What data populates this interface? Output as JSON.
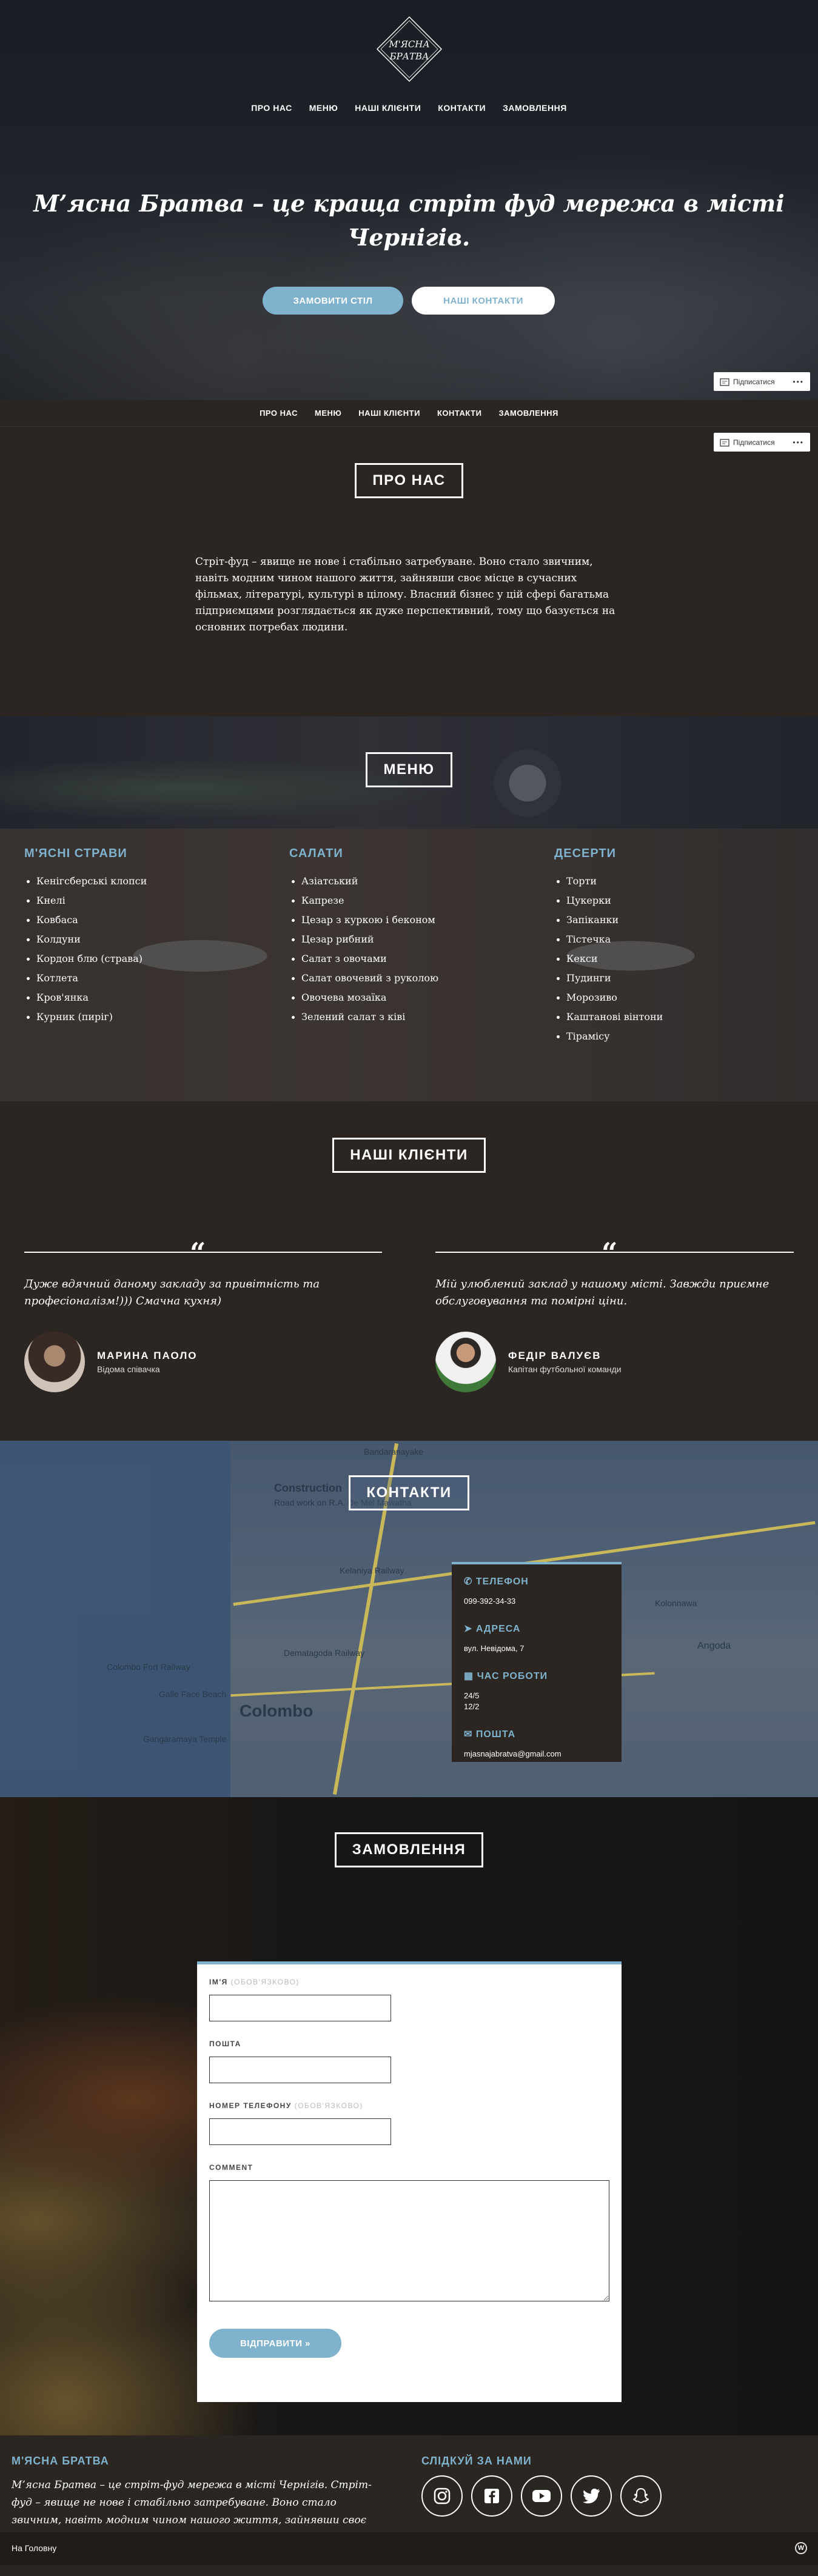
{
  "hero": {
    "logo_line1": "М'ЯСНА",
    "logo_line2": "БРАТВА",
    "title": "М’ясна Братва – це краща стріт фуд мережа в місті Чернігів.",
    "btn_order": "ЗАМОВИТИ СТІЛ",
    "btn_contacts": "НАШІ КОНТАКТИ"
  },
  "nav": [
    "ПРО НАС",
    "МЕНЮ",
    "НАШІ КЛІЄНТИ",
    "КОНТАКТИ",
    "ЗАМОВЛЕННЯ"
  ],
  "follow_label": "Підписатися",
  "about": {
    "title": "ПРО НАС",
    "text": "Стріт-фуд – явище не нове і стабільно затребуване. Воно стало звичним, навіть модним чином нашого життя, зайнявши своє місце в сучасних фільмах, літературі, культурі в цілому. Власний бізнес у цій сфері багатьма підприємцями розглядається як дуже перспективний, тому що базується на основних потребах людини."
  },
  "menu": {
    "title": "МЕНЮ",
    "columns": [
      {
        "heading": "М'ЯСНІ СТРАВИ",
        "items": [
          "Кенігсберські клопси",
          "Кнелі",
          "Ковбаса",
          "Колдуни",
          "Кордон блю (страва)",
          "Котлета",
          "Кров'янка",
          "Курник (пиріг)"
        ]
      },
      {
        "heading": "САЛАТИ",
        "items": [
          "Азіатський",
          "Капрезе",
          "Цезар з куркою і беконом",
          "Цезар рибний",
          "Салат з овочами",
          "Салат овочевий з руколою",
          "Овочева мозаїка",
          "Зелений салат з ківі"
        ]
      },
      {
        "heading": "ДЕСЕРТИ",
        "items": [
          "Торти",
          "Цукерки",
          "Запіканки",
          "Тістечка",
          "Кекси",
          "Пудинги",
          "Морозиво",
          "Каштанові вінтони",
          "Тірамісу"
        ]
      }
    ]
  },
  "clients": {
    "title": "НАШІ КЛІЄНТИ",
    "quote_mark": "“",
    "items": [
      {
        "text": "Дуже вдячний даному закладу за привітність та професіоналізм!))) Смачна кухня)",
        "name": "МАРИНА ПАОЛО",
        "role": "Відома співачка"
      },
      {
        "text": "Мій улюблений заклад у нашому місті. Завжди приємне обслуговування та помірні ціни.",
        "name": "ФЕДІР ВАЛУЄВ",
        "role": "Капітан футбольної команди"
      }
    ]
  },
  "contacts": {
    "title": "КОНТАКТИ",
    "phone_h": "ТЕЛЕФОН",
    "phone": "099-392-34-33",
    "address_h": "АДРЕСА",
    "address": "вул. Невідома, 7",
    "hours_h": "ЧАС РОБОТИ",
    "hours1": "24/5",
    "hours2": "12/2",
    "mail_h": "ПОШТА",
    "mail": "mjasnajabratva@gmail.com",
    "map_labels": [
      "Construction",
      "Road work on R.A. De Mel Mawatha",
      "Colombo Fort Railway",
      "Colombo",
      "Dematagoda Railway",
      "Kelaniya Railway",
      "Gangaramaya Temple",
      "Galle Face Beach",
      "Angoda",
      "Kolonnawa",
      "Bandaranayake"
    ]
  },
  "order": {
    "title": "ЗАМОВЛЕННЯ",
    "name_label": "ІМ'Я",
    "name_opt": "(ОБОВ'ЯЗКОВО)",
    "email_label": "ПОШТА",
    "phone_label": "НОМЕР ТЕЛЕФОНУ",
    "phone_opt": "(ОБОВ'ЯЗКОВО)",
    "comment_label": "COMMENT",
    "submit": "ВІДПРАВИТИ »"
  },
  "footer": {
    "brand_h": "М'ЯСНА БРАТВА",
    "brand_text": "М’ясна Братва – це стріт-фуд мережа в місті Чернігів. Стріт-фуд – явище не нове і стабільно затребуване. Воно стало звичним, навіть модним чином нашого життя, зайнявши своє місце в сучасних фільмах, літературі, культурі в цілому.",
    "social_h": "СЛІДКУЙ ЗА НАМИ",
    "social_icons": [
      "instagram-icon",
      "facebook-icon",
      "youtube-icon",
      "twitter-icon",
      "snapchat-icon"
    ],
    "home_link": "На Головну"
  },
  "colors": {
    "accent": "#7fb2cc",
    "bg_dark": "#2b2621",
    "white": "#ffffff"
  }
}
